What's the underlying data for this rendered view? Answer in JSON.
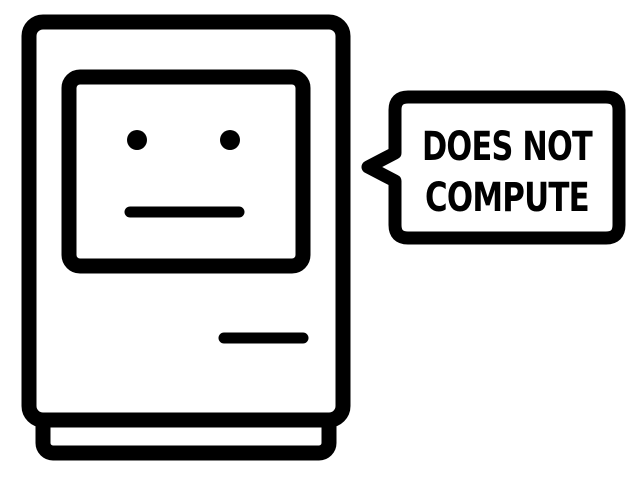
{
  "speech_bubble": {
    "line1": "DOES NOT",
    "line2": "COMPUTE"
  },
  "colors": {
    "stroke": "#000000",
    "background": "#ffffff"
  },
  "icons": [
    "classic-computer-icon",
    "neutral-face-icon",
    "speech-bubble-icon"
  ]
}
